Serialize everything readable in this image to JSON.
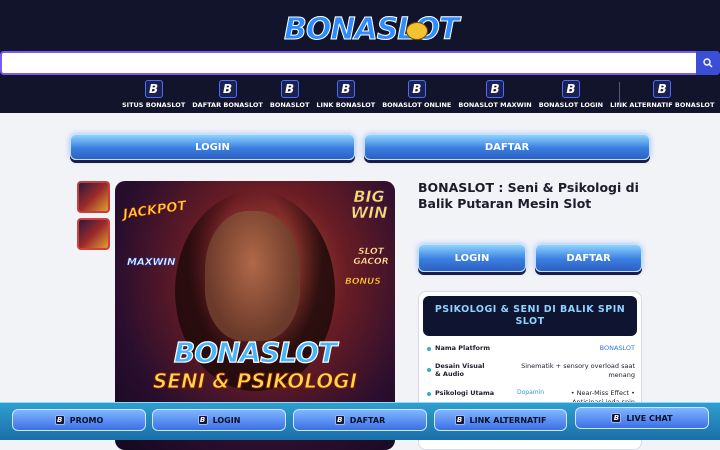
{
  "header": {
    "logo_text": "BONASLOT",
    "search": {
      "placeholder": "",
      "value": "",
      "button_icon": "search-icon"
    },
    "nav": [
      {
        "icon": "B",
        "label": "SITUS BONASLOT"
      },
      {
        "icon": "B",
        "label": "DAFTAR BONASLOT"
      },
      {
        "icon": "B",
        "label": "BONASLOT"
      },
      {
        "icon": "B",
        "label": "LINK BONASLOT"
      },
      {
        "icon": "B",
        "label": "BONASLOT ONLINE"
      },
      {
        "icon": "B",
        "label": "BONASLOT MAXWIN"
      },
      {
        "icon": "B",
        "label": "BONASLOT LOGIN"
      },
      {
        "icon": "B",
        "label": "LINK ALTERNATIF BONASLOT"
      }
    ]
  },
  "main": {
    "login_label": "LOGIN",
    "daftar_label": "DAFTAR"
  },
  "hero": {
    "jackpot": "JACKPOT",
    "maxwin": "MAXWIN",
    "big_win": "BIG WIN",
    "slot_gacor": "SLOT GACOR",
    "bonus": "BONUS",
    "brand": "BONASLOT",
    "subtitle": "SENI & PSIKOLOGI"
  },
  "product": {
    "title": "BONASLOT : Seni & Psikologi di Balik Putaran Mesin Slot",
    "login_label": "LOGIN",
    "daftar_label": "DAFTAR",
    "card_title": "PSIKOLOGI & SENI DI BALIK SPIN SLOT",
    "rows": [
      {
        "label": "Nama Platform",
        "value": "BONASLOT"
      },
      {
        "label": "Desain Visual & Audio",
        "value": "Sinematik + sensory overload saat menang"
      },
      {
        "label": "Psikologi Utama",
        "prefix": "Dopamin",
        "value": "• Near-Miss Effect • Antisipasi jeda spin"
      }
    ]
  },
  "bottom_bar": [
    {
      "icon": "B",
      "label": "PROMO"
    },
    {
      "icon": "B",
      "label": "LOGIN"
    },
    {
      "icon": "B",
      "label": "DAFTAR"
    },
    {
      "icon": "B",
      "label": "LINK ALTERNATIF"
    },
    {
      "icon": "B",
      "label": "LIVE CHAT"
    }
  ],
  "colors": {
    "header_bg": "#11142a",
    "button_gradient_top": "#8fd3ff",
    "button_gradient_bottom": "#2e5fc2",
    "bottom_bar": "#2f9fd0",
    "accent": "#2f7ad8"
  }
}
